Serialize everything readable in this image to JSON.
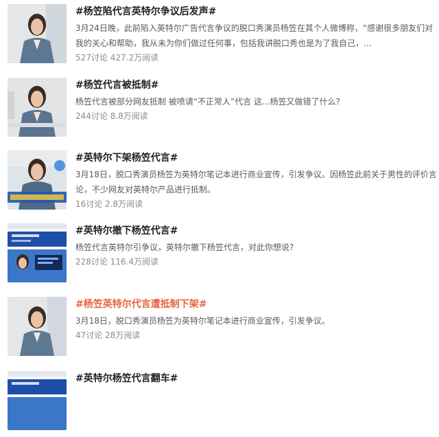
{
  "topics": [
    {
      "title": "#杨笠陷代言英特尔争议后发声#",
      "desc": "3月24日晚，此前陷入英特尔广告代言争议的脱口秀演员杨笠在其个人微博称，“感谢很多朋友们对我的关心和帮助，我从未为你们做过任何事，包括我讲脱口秀也是为了我自己，...",
      "stats": "527讨论 427.2万阅读",
      "thumb_icon": "person-photo"
    },
    {
      "title": "#杨笠代言被抵制#",
      "desc": "杨笠代言被部分网友抵制 被喷请“不正常人”代言 这...杨笠又做错了什么?",
      "stats": "244讨论 8.8万阅读",
      "thumb_icon": "person-photo"
    },
    {
      "title": "#英特尔下架杨笠代言#",
      "desc": "3月18日，脱口秀演员杨笠为英特尔笔记本进行商业宣传，引发争议。因杨笠此前关于男性的评价言论，不少网友对英特尔产品进行抵制。",
      "stats": "16讨论 2.8万阅读",
      "thumb_icon": "video-still"
    },
    {
      "title": "#英特尔撤下杨笠代言#",
      "desc": "杨笠代言英特尔引争议，英特尔撤下杨笠代言，对此你想说?",
      "stats": "228讨论 116.4万阅读",
      "thumb_icon": "webpage-screenshot"
    },
    {
      "title": "#杨笠英特尔代言遭抵制下架#",
      "desc": "3月18日，脱口秀演员杨笠为英特尔笔记本进行商业宣传，引发争议。",
      "stats": "47讨论 28万阅读",
      "thumb_icon": "person-photo"
    },
    {
      "title": "#英特尔杨笠代言翻车#",
      "desc": "",
      "stats": "",
      "thumb_icon": "webpage-screenshot"
    }
  ],
  "colors": {
    "title": "#222222",
    "title_highlight": "#e8643a",
    "desc": "#5a5a5a",
    "stats": "#8a8a8a"
  }
}
